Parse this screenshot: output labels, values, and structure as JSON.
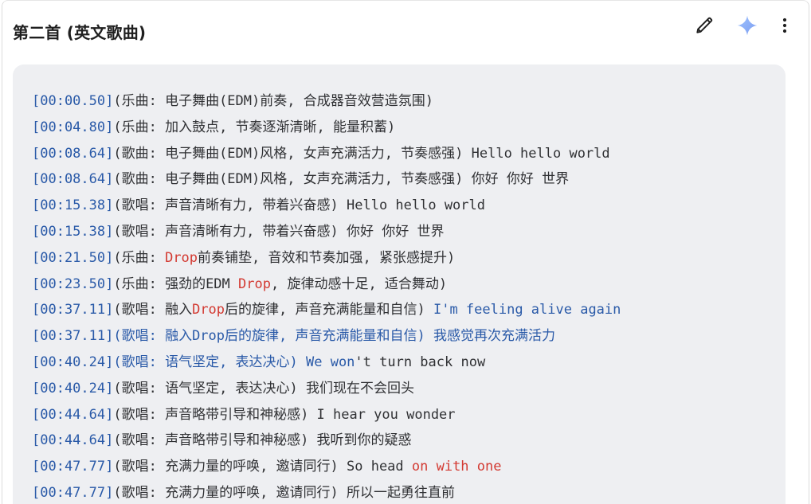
{
  "header": {
    "title": "第二首 (英文歌曲)",
    "icons": [
      "edit-icon",
      "sparkle-icon",
      "more-vert-icon"
    ]
  },
  "colors": {
    "timestamp": "#2a5aa8",
    "text": "#303134",
    "highlight": "#d33a32",
    "code_bg": "#eeeff2",
    "sparkle": "#8ab4f8"
  },
  "lyrics": [
    {
      "ts": "[00:00.50]",
      "parts": [
        {
          "t": "(乐曲: 电子舞曲(EDM)前奏, 合成器音效营造氛围)"
        }
      ]
    },
    {
      "ts": "[00:04.80]",
      "parts": [
        {
          "t": "(乐曲: 加入鼓点, 节奏逐渐清晰, 能量积蓄)"
        }
      ]
    },
    {
      "ts": "[00:08.64]",
      "parts": [
        {
          "t": "(歌曲: 电子舞曲(EDM)风格, 女声充满活力, 节奏感强) Hello hello world"
        }
      ]
    },
    {
      "ts": "[00:08.64]",
      "parts": [
        {
          "t": "(歌曲: 电子舞曲(EDM)风格, 女声充满活力, 节奏感强) 你好 你好 世界"
        }
      ]
    },
    {
      "ts": "[00:15.38]",
      "parts": [
        {
          "t": "(歌唱: 声音清晰有力, 带着兴奋感) Hello hello world"
        }
      ]
    },
    {
      "ts": "[00:15.38]",
      "parts": [
        {
          "t": "(歌唱: 声音清晰有力, 带着兴奋感) 你好 你好 世界"
        }
      ]
    },
    {
      "ts": "[00:21.50]",
      "parts": [
        {
          "t": "(乐曲: "
        },
        {
          "t": "Drop",
          "hl": true
        },
        {
          "t": "前奏铺垫, 音效和节奏加强, 紧张感提升)"
        }
      ]
    },
    {
      "ts": "[00:23.50]",
      "parts": [
        {
          "t": "(乐曲: 强劲的EDM "
        },
        {
          "t": "Drop",
          "hl": true
        },
        {
          "t": ", 旋律动感十足, 适合舞动)"
        }
      ]
    },
    {
      "ts": "[00:37.11]",
      "parts": [
        {
          "t": "(歌唱: 融入"
        },
        {
          "t": "Drop",
          "hl": true
        },
        {
          "t": "后的旋律, 声音充满能量和自信) "
        },
        {
          "t": "I'm feeling alive again",
          "blue": true
        }
      ]
    },
    {
      "ts": "[00:37.11]",
      "parts": [
        {
          "t": "(歌唱: 融入Drop后的旋律, 声音充满能量和自信) 我感觉再次充满活力",
          "blue": true
        }
      ]
    },
    {
      "ts": "[00:40.24]",
      "parts": [
        {
          "t": "(歌唱: 语气坚定, 表达决心) We won",
          "blue": true
        },
        {
          "t": "'t turn back now"
        }
      ]
    },
    {
      "ts": "[00:40.24]",
      "parts": [
        {
          "t": "(歌唱: 语气坚定, 表达决心) 我们现在不会回头"
        }
      ]
    },
    {
      "ts": "[00:44.64]",
      "parts": [
        {
          "t": "(歌唱: 声音略带引导和神秘感) I hear you wonder"
        }
      ]
    },
    {
      "ts": "[00:44.64]",
      "parts": [
        {
          "t": "(歌唱: 声音略带引导和神秘感) 我听到你的疑惑"
        }
      ]
    },
    {
      "ts": "[00:47.77]",
      "parts": [
        {
          "t": "(歌唱: 充满力量的呼唤, 邀请同行) So head "
        },
        {
          "t": "on with one",
          "hl": true
        }
      ]
    },
    {
      "ts": "[00:47.77]",
      "parts": [
        {
          "t": "(歌唱: 充满力量的呼唤, 邀请同行) 所以一起勇往直前"
        }
      ]
    }
  ]
}
